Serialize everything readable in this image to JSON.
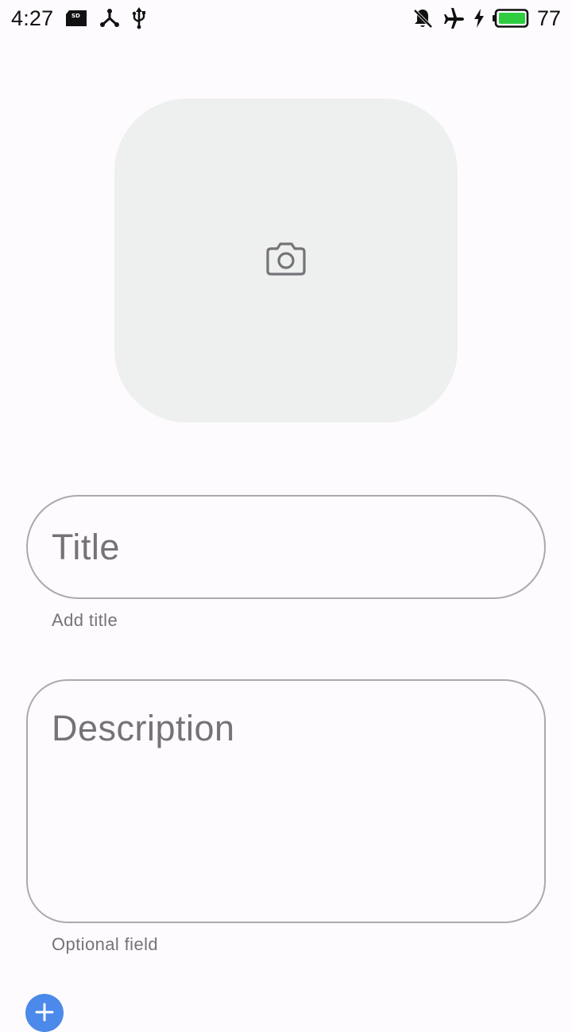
{
  "status_bar": {
    "time": "4:27",
    "left_icons": [
      "sd-card-icon",
      "usb-tethering-icon",
      "usb-icon"
    ],
    "right_icons": [
      "notifications-off-icon",
      "airplane-mode-icon",
      "charging-icon",
      "battery-icon"
    ],
    "battery_level": "77",
    "battery_color": "#2ecc40"
  },
  "photo_picker": {
    "icon": "camera-icon"
  },
  "form": {
    "title": {
      "placeholder": "Title",
      "helper": "Add title"
    },
    "description": {
      "placeholder": "Description",
      "helper": "Optional field"
    }
  },
  "fab": {
    "icon": "add-icon",
    "color": "#4b89ea"
  }
}
